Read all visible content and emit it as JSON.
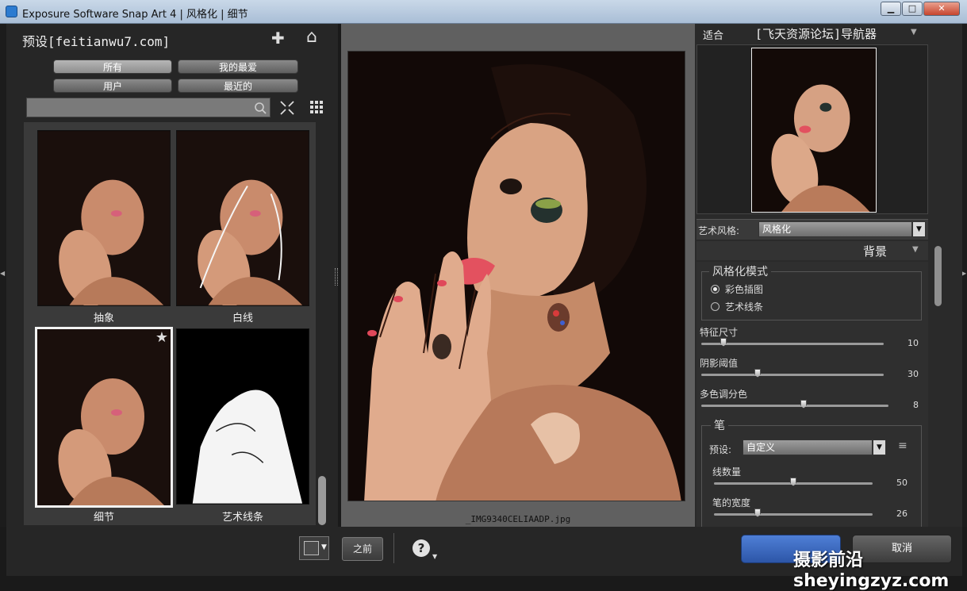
{
  "window": {
    "title": "Exposure Software Snap Art 4 | 风格化 | 细节",
    "minimize": "▁",
    "maximize": "□",
    "close": "✕"
  },
  "presets": {
    "title": "预设[feitianwu7.com]",
    "add": "✚",
    "home": "⌂",
    "filters": [
      "所有",
      "我的最爱",
      "用户",
      "最近的"
    ],
    "search_placeholder": "",
    "items": [
      {
        "label": "抽象"
      },
      {
        "label": "白线"
      },
      {
        "label": "细节",
        "star": "★"
      },
      {
        "label": "艺术线条"
      }
    ]
  },
  "preview": {
    "filename": "_IMG9340CELIAADP.jpg"
  },
  "navigator": {
    "fit": "适合",
    "title": "[飞天资源论坛]导航器",
    "collapse": "▼"
  },
  "style": {
    "label": "艺术风格:",
    "value": "风格化"
  },
  "background": {
    "title": "背景",
    "mode_title": "风格化模式",
    "modes": [
      {
        "label": "彩色插图",
        "checked": true
      },
      {
        "label": "艺术线条",
        "checked": false
      }
    ],
    "sliders": [
      {
        "label": "特征尺寸",
        "value": "10",
        "pos": 0.12
      },
      {
        "label": "阴影阈值",
        "value": "30",
        "pos": 0.3
      },
      {
        "label": "多色调分色",
        "value": "8",
        "pos": 0.5
      }
    ]
  },
  "pen": {
    "title": "笔",
    "preset_label": "预设:",
    "preset_value": "自定义",
    "menu": "≡",
    "sliders": [
      {
        "label": "线数量",
        "value": "50",
        "pos": 0.5
      },
      {
        "label": "笔的宽度",
        "value": "26",
        "pos": 0.26
      }
    ]
  },
  "toolbar": {
    "before": "之前",
    "help": "?",
    "ok": "",
    "cancel": "取消"
  },
  "watermark": "摄影前沿sheyingzyz.com",
  "nav_arrows": {
    "left": "◀",
    "right": "▶"
  }
}
